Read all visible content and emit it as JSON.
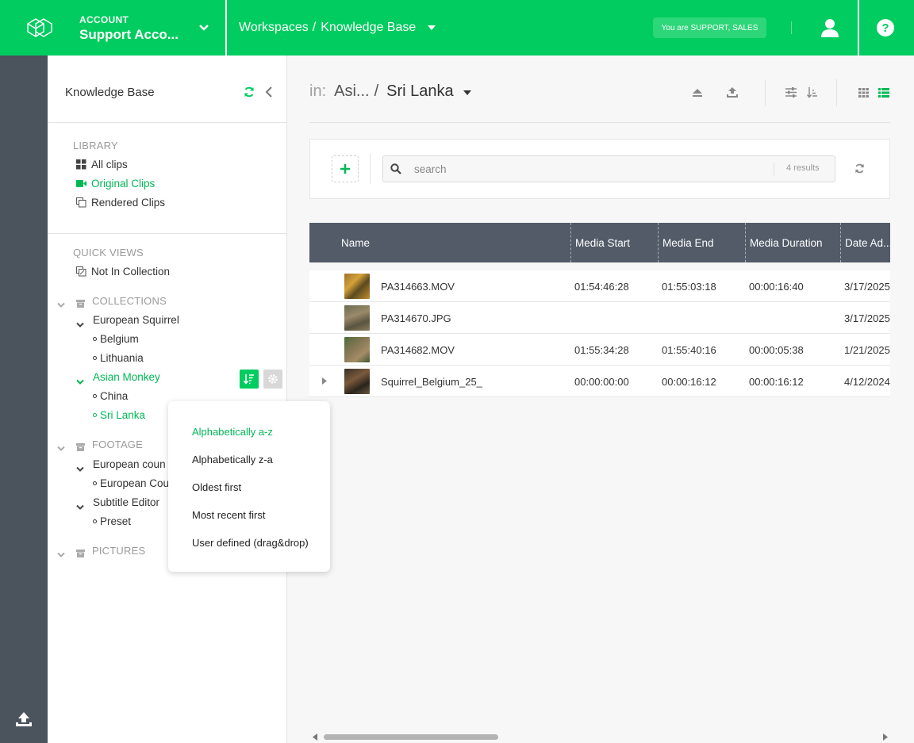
{
  "topbar": {
    "account_label": "ACCOUNT",
    "account_name": "Support Acco...",
    "breadcrumb": [
      "Workspaces",
      "Knowledge Base"
    ],
    "breadcrumb_sep": "/",
    "role_badge": "You are SUPPORT, SALES",
    "accent_color": "#00cc5f"
  },
  "sidebar": {
    "title": "Knowledge Base",
    "library_label": "LIBRARY",
    "library_items": [
      "All clips",
      "Original Clips",
      "Rendered Clips"
    ],
    "quick_views_label": "QUICK VIEWS",
    "quick_views_items": [
      "Not In Collection"
    ],
    "collections_label": "COLLECTIONS",
    "collections": {
      "european_squirrel": "European Squirrel",
      "belgium": "Belgium",
      "lithuania": "Lithuania",
      "asian_monkey": "Asian Monkey",
      "china": "China",
      "sri_lanka": "Sri Lanka"
    },
    "footage_label": "FOOTAGE",
    "footage": {
      "european_coun": "European coun",
      "european_cou_child": "European Cou",
      "subtitle_editor": "Subtitle Editor",
      "preset": "Preset"
    },
    "pictures_label": "PICTURES"
  },
  "sort_menu": {
    "options": [
      "Alphabetically a-z",
      "Alphabetically z-a",
      "Oldest first",
      "Most recent first",
      "User defined (drag&drop)"
    ],
    "selected": "Alphabetically a-z"
  },
  "main": {
    "in_label": "in:",
    "path_parent": "Asi...",
    "path_sep": "/",
    "path_current": "Sri Lanka",
    "search_placeholder": "search",
    "results_count": "4 results",
    "columns": [
      "Name",
      "Media Start",
      "Media End",
      "Media Duration",
      "Date Ad..."
    ],
    "rows": [
      {
        "name": "PA314663.MOV",
        "media_start": "01:54:46:28",
        "media_end": "01:55:03:18",
        "media_duration": "00:00:16:40",
        "date_added": "3/17/2025",
        "thumb": "autumn-squirrel",
        "expandable": false
      },
      {
        "name": "PA314670.JPG",
        "media_start": "",
        "media_end": "",
        "media_duration": "",
        "date_added": "3/17/2025",
        "thumb": "monkeys",
        "expandable": false
      },
      {
        "name": "PA314682.MOV",
        "media_start": "01:55:34:28",
        "media_end": "01:55:40:16",
        "media_duration": "00:00:05:38",
        "date_added": "1/21/2025",
        "thumb": "monkey",
        "expandable": false
      },
      {
        "name": "Squirrel_Belgium_25_",
        "media_start": "00:00:00:00",
        "media_end": "00:00:16:12",
        "media_duration": "00:00:16:12",
        "date_added": "4/12/2024",
        "thumb": "squirrel",
        "expandable": true
      }
    ]
  }
}
